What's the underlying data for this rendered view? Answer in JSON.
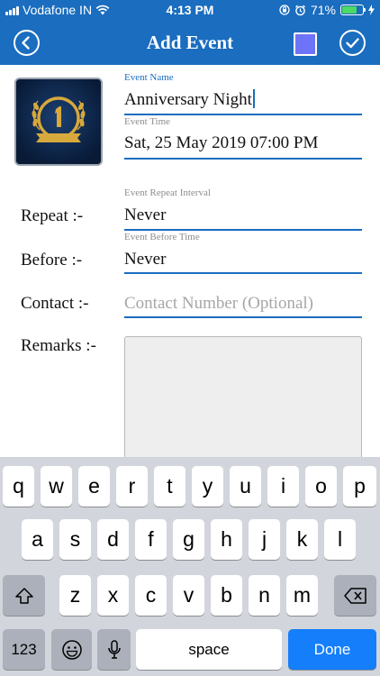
{
  "status_bar": {
    "carrier": "Vodafone IN",
    "time": "4:13 PM",
    "battery": "71%",
    "battery_level": 0.71
  },
  "nav": {
    "title": "Add Event",
    "color_swatch": "#6e74f7"
  },
  "form": {
    "event_name": {
      "label": "Event Name",
      "value": "Anniversary Night"
    },
    "event_time": {
      "label": "Event Time",
      "value": "Sat, 25 May 2019 07:00 PM"
    },
    "repeat": {
      "row_label": "Repeat :-",
      "label": "Event Repeat Interval",
      "value": "Never"
    },
    "before": {
      "row_label": "Before :-",
      "label": "Event Before Time",
      "value": "Never"
    },
    "contact": {
      "row_label": "Contact :-",
      "placeholder": "Contact Number (Optional)"
    },
    "remarks": {
      "row_label": "Remarks :-"
    }
  },
  "keyboard": {
    "row1": [
      "q",
      "w",
      "e",
      "r",
      "t",
      "y",
      "u",
      "i",
      "o",
      "p"
    ],
    "row2": [
      "a",
      "s",
      "d",
      "f",
      "g",
      "h",
      "j",
      "k",
      "l"
    ],
    "row3": [
      "z",
      "x",
      "c",
      "v",
      "b",
      "n",
      "m"
    ],
    "numbers_key": "123",
    "space_key": "space",
    "done_key": "Done"
  },
  "colors": {
    "primary": "#1a6dbf",
    "done_key": "#147efb"
  }
}
